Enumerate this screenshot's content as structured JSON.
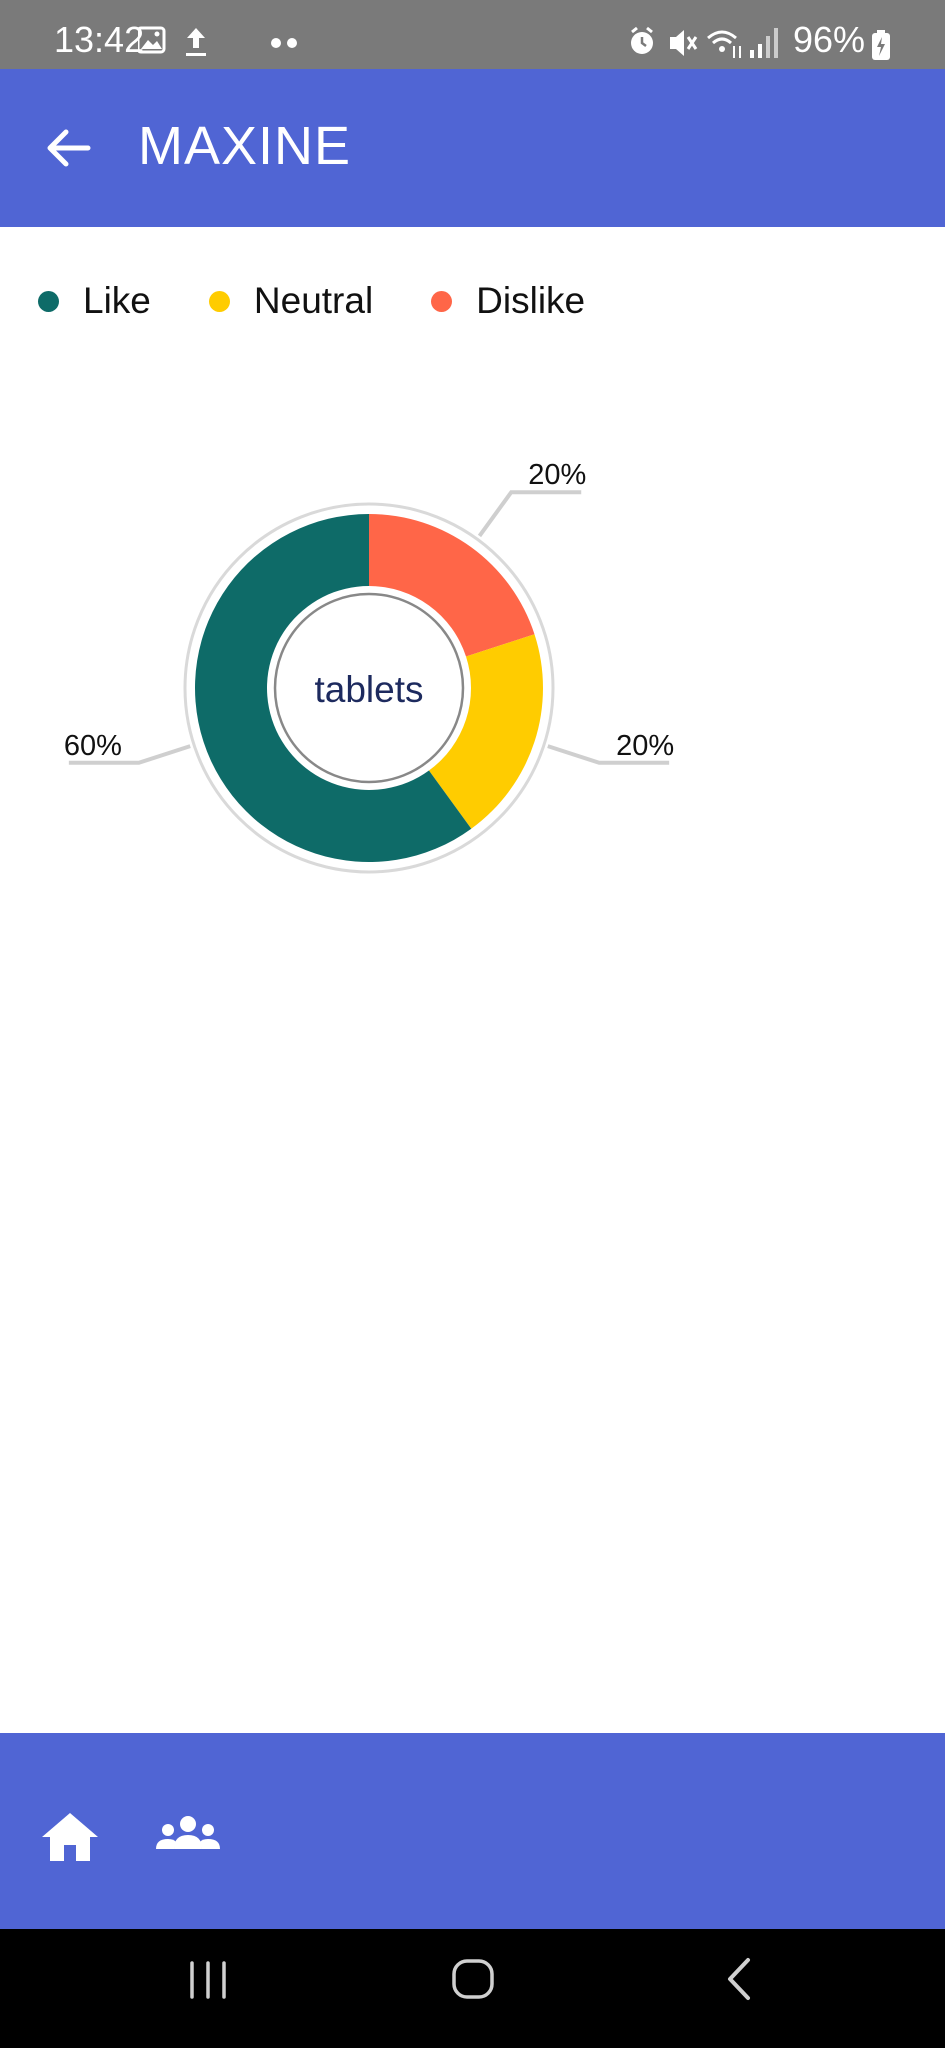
{
  "status_bar": {
    "time": "13:42",
    "battery": "96%",
    "left_icons": [
      "image-icon",
      "upload-icon"
    ],
    "right_icons": [
      "alarm-icon",
      "mute-icon",
      "wifi-icon",
      "signal-icon",
      "battery-icon"
    ]
  },
  "app_bar": {
    "title": "MAXINE",
    "back_icon": "arrow-left-icon",
    "background_color": "#5065d4"
  },
  "legend": [
    {
      "label": "Like",
      "color": "#0e6b68"
    },
    {
      "label": "Neutral",
      "color": "#ffcc00"
    },
    {
      "label": "Dislike",
      "color": "#ff6648"
    }
  ],
  "chart_data": {
    "type": "pie",
    "subtype": "donut",
    "center_label": "tablets",
    "slices": [
      {
        "name": "Dislike",
        "value": 20,
        "label": "20%",
        "color": "#ff6648"
      },
      {
        "name": "Neutral",
        "value": 20,
        "label": "20%",
        "color": "#ffcc00"
      },
      {
        "name": "Like",
        "value": 60,
        "label": "60%",
        "color": "#0e6b68"
      }
    ],
    "legend_position": "top-left"
  },
  "bottom_nav": {
    "items": [
      {
        "name": "home",
        "icon": "home-icon"
      },
      {
        "name": "groups",
        "icon": "people-icon"
      }
    ]
  },
  "system_nav": {
    "buttons": [
      "recent-apps-icon",
      "home-circle-icon",
      "back-chevron-icon"
    ]
  }
}
